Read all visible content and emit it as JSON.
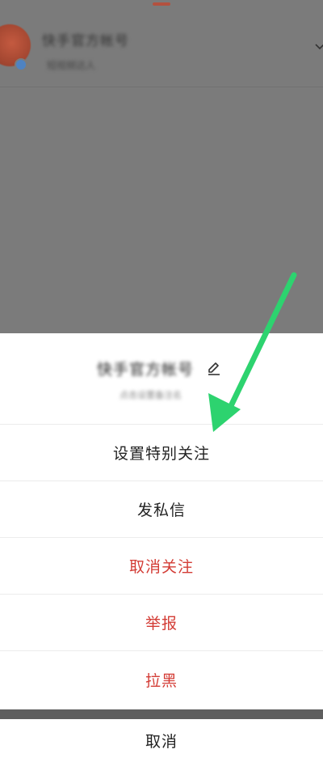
{
  "background_page": {
    "account_name": "快手官方帐号",
    "account_subtitle": "短视频达人"
  },
  "sheet": {
    "account_name": "快手官方帐号",
    "account_subtitle": "点击设置备注名"
  },
  "menu": {
    "special_follow": "设置特别关注",
    "private_message": "发私信",
    "unfollow": "取消关注",
    "report": "举报",
    "block": "拉黑",
    "cancel": "取消"
  },
  "colors": {
    "danger": "#d33c35",
    "arrow": "#2dd36f",
    "overlay": "#7b7b7b"
  }
}
